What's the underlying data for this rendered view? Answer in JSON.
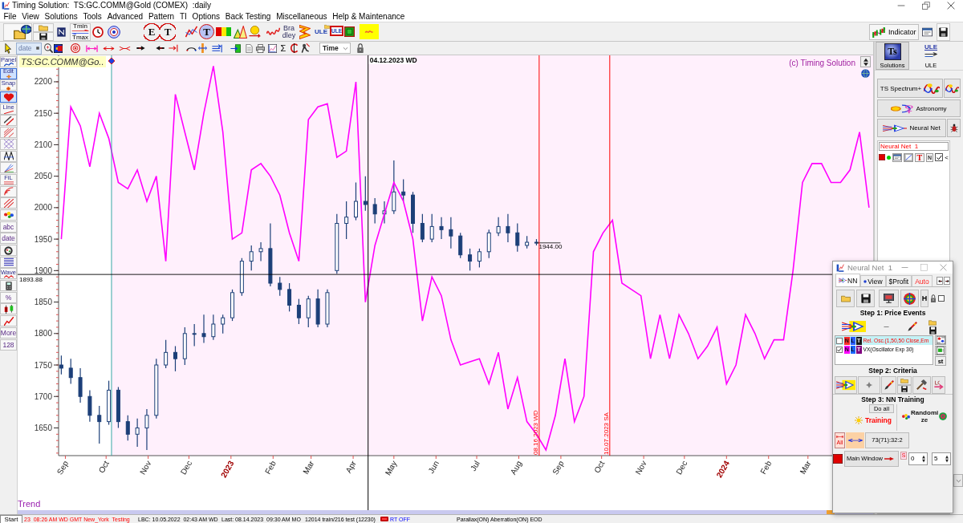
{
  "window": {
    "title": "Timing Solution:  TS:GC.COMM@Gold (COMEX)  :daily"
  },
  "menu": [
    "File",
    "View",
    "Solutions",
    "Tools",
    "Advanced",
    "Pattern",
    "TI",
    "Options",
    "Back Testing",
    "Miscellaneous",
    "Help & Maintenance"
  ],
  "toolbar": {
    "labels": [
      "Tmin",
      "Tmax",
      "E",
      "T",
      "T",
      "Bra dley",
      "ULE",
      "ULE"
    ],
    "indicator": "Indicator"
  },
  "toolbar_2": {
    "date": "date",
    "sigma": "Σ",
    "time_select": "Time"
  },
  "left_tools": [
    {
      "label": "Panel",
      "pressed": false
    },
    {
      "label": "Edit",
      "pressed": true
    },
    {
      "label": "Snap",
      "pressed": false
    },
    {
      "pressed": true
    },
    {
      "label": "Line",
      "pressed": false
    },
    {
      "pressed": false
    },
    {
      "pressed": false
    },
    {
      "pressed": false
    },
    {
      "pressed": false
    },
    {
      "pressed": false
    },
    {
      "label": "FiL",
      "pressed": false
    },
    {
      "pressed": false
    },
    {
      "pressed": false
    },
    {
      "pressed": false
    },
    {
      "label": "abc",
      "pressed": false
    },
    {
      "label": "date",
      "pressed": false
    },
    {
      "pressed": false
    },
    {
      "pressed": false
    },
    {
      "label": "Wave",
      "pressed": false
    },
    {
      "pressed": false
    },
    {
      "label": "%",
      "pressed": false
    },
    {
      "pressed": false
    },
    {
      "pressed": false
    },
    {
      "label": "More",
      "pressed": false
    },
    {
      "label": "128",
      "pressed": false
    }
  ],
  "chart": {
    "symbol": "TS:GC.COMM@Go..",
    "copyright": "(c) Timing Solution",
    "panel_label": "Trend",
    "chart_data": [
      {
        "type": "line",
        "xlim": [
          "2022-08-27",
          "2024-04-18"
        ],
        "ylim": [
          1606,
          2242
        ],
        "xticks": [
          {
            "value": "2022-09-01",
            "label": "Sep"
          },
          {
            "value": "2022-10-01",
            "label": "Oct"
          },
          {
            "value": "2022-11-01",
            "label": "Nov"
          },
          {
            "value": "2022-12-01",
            "label": "Dec"
          },
          {
            "value": "2023-01-01",
            "label": "2023"
          },
          {
            "value": "2023-02-01",
            "label": "Feb"
          },
          {
            "value": "2023-03-01",
            "label": "Mar"
          },
          {
            "value": "2023-04-01",
            "label": "Apr"
          },
          {
            "value": "2023-05-01",
            "label": "May"
          },
          {
            "value": "2023-06-01",
            "label": "Jun"
          },
          {
            "value": "2023-07-01",
            "label": "Jul"
          },
          {
            "value": "2023-08-01",
            "label": "Aug"
          },
          {
            "value": "2023-09-01",
            "label": "Sep"
          },
          {
            "value": "2023-10-01",
            "label": "Oct"
          },
          {
            "value": "2023-11-01",
            "label": "Nov"
          },
          {
            "value": "2023-12-01",
            "label": "Dec"
          },
          {
            "value": "2024-01-01",
            "label": "2024"
          },
          {
            "value": "2024-02-01",
            "label": "Feb"
          },
          {
            "value": "2024-03-01",
            "label": "Mar"
          }
        ],
        "yticks": [
          1650,
          1700,
          1750,
          1800,
          1850,
          1900,
          1950,
          2000,
          2050,
          2100,
          2150,
          2200
        ],
        "bands": [
          {
            "axis": "x",
            "from": "2022-10-05",
            "to": "2024-04-18",
            "color": "#fff0fc"
          }
        ],
        "ref_lines": [
          {
            "axis": "x",
            "value": "2022-10-05",
            "color": "#3aa6a6"
          },
          {
            "axis": "x",
            "value": "2023-04-12",
            "label": "04.12.2023 WD",
            "color": "#000000"
          },
          {
            "axis": "x",
            "value": "2023-08-16",
            "label": "08.16.2023 WD",
            "color": "#ff0000"
          },
          {
            "axis": "x",
            "value": "2023-10-07",
            "label": "10.07.2023 SA",
            "color": "#ff0000"
          },
          {
            "axis": "y",
            "value": 1893.88,
            "label": "1893.88",
            "color": "#000000"
          }
        ],
        "series": [
          {
            "type": "candlestick",
            "color": "#1c3f78",
            "x": [
              "2022-08-29",
              "2022-09-05",
              "2022-09-12",
              "2022-09-19",
              "2022-09-26",
              "2022-10-03",
              "2022-10-10",
              "2022-10-17",
              "2022-10-24",
              "2022-10-31",
              "2022-11-07",
              "2022-11-14",
              "2022-11-21",
              "2022-11-28",
              "2022-12-05",
              "2022-12-12",
              "2022-12-19",
              "2022-12-26",
              "2023-01-02",
              "2023-01-09",
              "2023-01-16",
              "2023-01-23",
              "2023-01-30",
              "2023-02-06",
              "2023-02-13",
              "2023-02-20",
              "2023-02-27",
              "2023-03-06",
              "2023-03-13",
              "2023-03-20",
              "2023-03-27",
              "2023-04-03",
              "2023-04-10",
              "2023-04-17",
              "2023-04-24",
              "2023-05-01",
              "2023-05-08",
              "2023-05-15",
              "2023-05-22",
              "2023-05-29",
              "2023-06-05",
              "2023-06-12",
              "2023-06-19",
              "2023-06-26",
              "2023-07-03",
              "2023-07-10",
              "2023-07-17",
              "2023-07-24",
              "2023-07-31",
              "2023-08-07",
              "2023-08-14"
            ],
            "ohlc": [
              [
                1750,
                1765,
                1735,
                1745
              ],
              [
                1745,
                1760,
                1720,
                1730
              ],
              [
                1730,
                1745,
                1690,
                1700
              ],
              [
                1700,
                1710,
                1660,
                1670
              ],
              [
                1670,
                1685,
                1625,
                1660
              ],
              [
                1660,
                1725,
                1655,
                1710
              ],
              [
                1710,
                1715,
                1650,
                1660
              ],
              [
                1660,
                1670,
                1630,
                1640
              ],
              [
                1640,
                1665,
                1620,
                1650
              ],
              [
                1650,
                1680,
                1615,
                1670
              ],
              [
                1670,
                1760,
                1665,
                1750
              ],
              [
                1750,
                1790,
                1745,
                1770
              ],
              [
                1770,
                1780,
                1740,
                1760
              ],
              [
                1760,
                1810,
                1750,
                1800
              ],
              [
                1800,
                1815,
                1780,
                1800
              ],
              [
                1800,
                1830,
                1785,
                1795
              ],
              [
                1795,
                1830,
                1790,
                1815
              ],
              [
                1815,
                1830,
                1800,
                1825
              ],
              [
                1825,
                1870,
                1820,
                1865
              ],
              [
                1865,
                1920,
                1860,
                1915
              ],
              [
                1915,
                1940,
                1900,
                1930
              ],
              [
                1930,
                1945,
                1915,
                1935
              ],
              [
                1935,
                1975,
                1875,
                1880
              ],
              [
                1880,
                1890,
                1860,
                1870
              ],
              [
                1870,
                1880,
                1835,
                1845
              ],
              [
                1845,
                1855,
                1815,
                1825
              ],
              [
                1825,
                1860,
                1810,
                1855
              ],
              [
                1855,
                1870,
                1810,
                1815
              ],
              [
                1815,
                1870,
                1810,
                1865
              ],
              [
                1900,
                1990,
                1895,
                1975
              ],
              [
                1975,
                2010,
                1950,
                1985
              ],
              [
                1985,
                2040,
                1980,
                2010
              ],
              [
                2010,
                2050,
                1995,
                2005
              ],
              [
                2005,
                2015,
                1975,
                1990
              ],
              [
                1990,
                2010,
                1975,
                1995
              ],
              [
                1995,
                2075,
                1990,
                2025
              ],
              [
                2025,
                2045,
                2010,
                2020
              ],
              [
                2020,
                2025,
                1960,
                1975
              ],
              [
                1975,
                1990,
                1945,
                1950
              ],
              [
                1950,
                1990,
                1945,
                1970
              ],
              [
                1970,
                1985,
                1950,
                1965
              ],
              [
                1965,
                1985,
                1935,
                1955
              ],
              [
                1955,
                1960,
                1920,
                1925
              ],
              [
                1925,
                1935,
                1900,
                1915
              ],
              [
                1915,
                1935,
                1905,
                1930
              ],
              [
                1930,
                1965,
                1920,
                1960
              ],
              [
                1960,
                1985,
                1955,
                1970
              ],
              [
                1970,
                1990,
                1945,
                1960
              ],
              [
                1960,
                1975,
                1930,
                1940
              ],
              [
                1940,
                1955,
                1935,
                1945
              ],
              [
                1945,
                1950,
                1940,
                1944
              ]
            ]
          },
          {
            "type": "line",
            "color": "#ff00ff",
            "x": [
              "2022-08-29",
              "2022-09-05",
              "2022-09-12",
              "2022-09-19",
              "2022-09-26",
              "2022-10-03",
              "2022-10-10",
              "2022-10-17",
              "2022-10-24",
              "2022-10-31",
              "2022-11-07",
              "2022-11-14",
              "2022-11-21",
              "2022-11-28",
              "2022-12-05",
              "2022-12-12",
              "2022-12-19",
              "2022-12-26",
              "2023-01-02",
              "2023-01-09",
              "2023-01-16",
              "2023-01-23",
              "2023-01-30",
              "2023-02-06",
              "2023-02-13",
              "2023-02-20",
              "2023-02-27",
              "2023-03-06",
              "2023-03-13",
              "2023-03-20",
              "2023-03-27",
              "2023-04-03",
              "2023-04-10",
              "2023-04-17",
              "2023-04-24",
              "2023-05-01",
              "2023-05-08",
              "2023-05-15",
              "2023-05-22",
              "2023-05-29",
              "2023-06-05",
              "2023-06-12",
              "2023-06-19",
              "2023-06-26",
              "2023-07-03",
              "2023-07-10",
              "2023-07-17",
              "2023-07-24",
              "2023-07-31",
              "2023-08-07",
              "2023-08-14",
              "2023-08-21",
              "2023-08-28",
              "2023-09-04",
              "2023-09-11",
              "2023-09-18",
              "2023-09-25",
              "2023-10-02",
              "2023-10-09",
              "2023-10-16",
              "2023-10-23",
              "2023-10-30",
              "2023-11-06",
              "2023-11-13",
              "2023-11-20",
              "2023-11-27",
              "2023-12-04",
              "2023-12-11",
              "2023-12-18",
              "2023-12-25",
              "2024-01-01",
              "2024-01-08",
              "2024-01-15",
              "2024-01-22",
              "2024-01-29",
              "2024-02-05",
              "2024-02-12",
              "2024-02-19",
              "2024-02-26",
              "2024-03-04",
              "2024-03-11",
              "2024-03-18",
              "2024-03-25",
              "2024-04-01",
              "2024-04-08",
              "2024-04-15"
            ],
            "values": [
              1950,
              2160,
              2130,
              2065,
              2150,
              2110,
              2040,
              2030,
              2060,
              2010,
              2050,
              1915,
              2180,
              2120,
              2060,
              2150,
              2225,
              2120,
              1950,
              1960,
              2060,
              2070,
              2050,
              2020,
              1960,
              1915,
              2140,
              2160,
              2165,
              2080,
              2090,
              2200,
              1850,
              1940,
              1990,
              2040,
              2010,
              1950,
              1820,
              1890,
              1860,
              1790,
              1750,
              1755,
              1760,
              1720,
              1770,
              1680,
              1730,
              1660,
              1640,
              1615,
              1670,
              1760,
              1660,
              1700,
              1930,
              1960,
              1980,
              1880,
              1870,
              1860,
              1760,
              1830,
              1760,
              1830,
              1800,
              1760,
              1780,
              1810,
              1720,
              1750,
              1830,
              1800,
              1760,
              1790,
              1790,
              1900,
              2040,
              2070,
              2070,
              2040,
              2040,
              2060,
              2120,
              2000
            ]
          }
        ],
        "annotations": [
          "1944.00"
        ]
      }
    ]
  },
  "right_panel": {
    "tabs": [
      {
        "label": "Solutions",
        "icon_text": "Ts",
        "selected": true
      },
      {
        "label": "ULE",
        "icon_text": "ULE",
        "selected": false
      }
    ],
    "buttons": [
      "TS Spectrum+",
      "Astronomy",
      "Neural Net"
    ],
    "model": {
      "name": "Neural Net  1",
      "labels": [
        "T",
        "N",
        "<"
      ],
      "checked": true
    }
  },
  "nn_window": {
    "title": "Neural Net  1",
    "tabs": [
      {
        "label": "NN",
        "kind": "page",
        "selected": true
      },
      {
        "label": "View",
        "kind": "page",
        "selected": false
      },
      {
        "label": "$Profit",
        "kind": "page",
        "selected": false
      },
      {
        "label": "Auto",
        "kind": "mode",
        "selected": false
      }
    ],
    "h_button": "H",
    "lock_checked": false,
    "steps": [
      "Step 1: Price Events",
      "Step 2: Criteria",
      "Step 3: NN Training"
    ],
    "events": [
      {
        "checked": false,
        "selected": true,
        "text": "Rel. Osc.(1,50,50 Close,Em",
        "badges": [
          {
            "text": "N",
            "color": "#ff2a2a"
          },
          {
            "text": "L",
            "color": "#2a5cff"
          },
          {
            "text": "T",
            "color": "#1a1a1a"
          }
        ]
      },
      {
        "checked": true,
        "selected": false,
        "text": "VX(Oscillator Exp 30)",
        "badges": [
          {
            "text": "N",
            "color": "#ff00ff"
          },
          {
            "text": "L",
            "color": "#1a66ff"
          },
          {
            "text": "T",
            "color": "#800080"
          }
        ]
      }
    ],
    "side_label": "st",
    "do_all": "Do all",
    "training": "Training",
    "randomize": "Randomi ze",
    "all_label": "All",
    "result": "73(71):32:2",
    "main_window": "Main Window",
    "s_label": "S",
    "spinners": [
      "0",
      "5"
    ]
  },
  "status_bar": {
    "start": "Start",
    "items": [
      {
        "kind": "alert",
        "text": "23  08:26 AM WD GMT New_York  Testing"
      },
      {
        "kind": "text",
        "text": "LBC: 10.05.2022  02:43 AM WD"
      },
      {
        "kind": "text",
        "text": "Last: 08.14.2023  09:30 AM MO"
      },
      {
        "kind": "text",
        "text": "12014 train/216 test (12230)"
      },
      {
        "kind": "status",
        "text": "RT OFF"
      },
      {
        "kind": "text",
        "text": "Parallax(ON) Aberration(ON) EOD"
      }
    ]
  }
}
